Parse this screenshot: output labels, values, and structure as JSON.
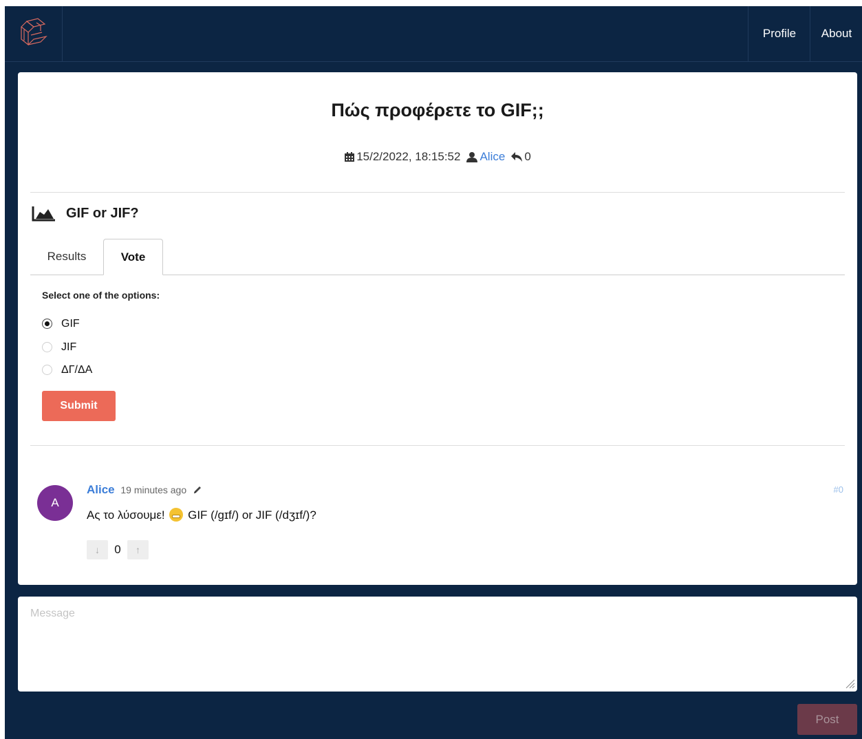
{
  "nav": {
    "profile_label": "Profile",
    "about_label": "About"
  },
  "thread": {
    "title": "Πώς προφέρετε το GIF;;",
    "date": "15/2/2022, 18:15:52",
    "author": "Alice",
    "replies": "0"
  },
  "poll": {
    "title": "GIF or JIF?",
    "tabs": [
      "Results",
      "Vote"
    ],
    "active_tab": "Vote",
    "prompt": "Select one of the options:",
    "options": [
      "GIF",
      "JIF",
      "ΔΓ/ΔΑ"
    ],
    "selected_option": "GIF",
    "submit_label": "Submit"
  },
  "comment": {
    "avatar_letter": "A",
    "author": "Alice",
    "time": "19 minutes ago",
    "number": "#0",
    "text_before_emoji": "Ας το λύσουμε!",
    "text_after_emoji": "GIF (/ɡɪf/) or JIF (/dʒɪf/)?",
    "score": "0"
  },
  "composer": {
    "placeholder": "Message",
    "post_label": "Post"
  },
  "colors": {
    "background": "#0c2543",
    "accent": "#ec6a58",
    "link": "#3b7dd8",
    "avatar": "#7a2f95",
    "post_disabled": "#6b3a49"
  },
  "icons": [
    "logo-icon",
    "calendar-icon",
    "user-icon",
    "reply-icon",
    "area-chart-icon",
    "pencil-icon",
    "arrow-down-icon",
    "arrow-up-icon",
    "resize-grip-icon"
  ]
}
